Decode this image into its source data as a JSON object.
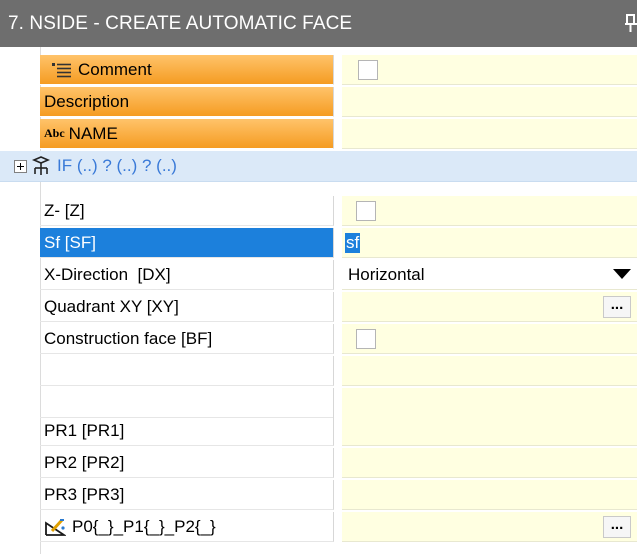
{
  "panel": {
    "title": "7. NSIDE - CREATE AUTOMATIC FACE"
  },
  "rows": {
    "comment": {
      "label": "Comment",
      "icon": "comment-lines-icon"
    },
    "description": {
      "label": "Description"
    },
    "name": {
      "prefix": "Abc",
      "label": "NAME"
    },
    "if_group": {
      "label": "IF (..) ? (..) ? (..)",
      "icon": "condition-icon"
    },
    "z": {
      "label": "Z- [Z]"
    },
    "sf": {
      "label": "Sf [SF]",
      "value": "sf"
    },
    "x_direction": {
      "label": "X-Direction  [DX]",
      "value": "Horizontal"
    },
    "quadrant": {
      "label": "Quadrant XY [XY]",
      "button": "..."
    },
    "construction_face": {
      "label": "Construction face [BF]"
    },
    "pr1": {
      "label": "PR1 [PR1]"
    },
    "pr2": {
      "label": "PR2 [PR2]"
    },
    "pr3": {
      "label": "PR3 [PR3]"
    },
    "points": {
      "label": "P0{_}_P1{_}_P2{_}",
      "icon": "draw-geometry-icon",
      "button": "..."
    }
  },
  "colors": {
    "title_bg": "#6e6e6e",
    "orange_header": "#f59c22",
    "selection": "#1c80dc",
    "value_bg": "#ffffe1",
    "group_bg": "#dbe9f8"
  }
}
